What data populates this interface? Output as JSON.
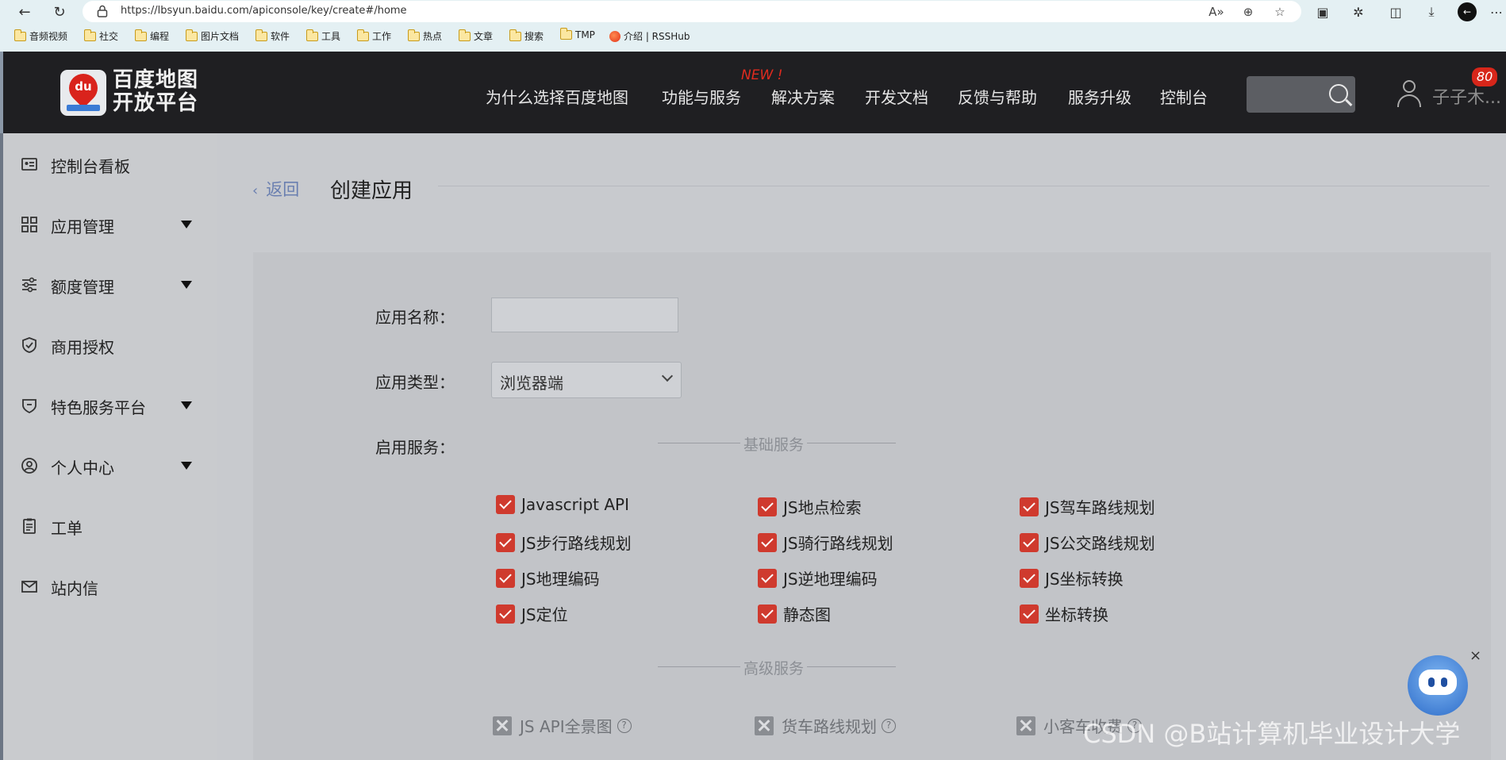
{
  "browser": {
    "url": "https://lbsyun.baidu.com/apiconsole/key/create#/home",
    "bookmarks": [
      "音频视频",
      "社交",
      "编程",
      "图片文档",
      "软件",
      "工具",
      "工作",
      "热点",
      "文章",
      "搜索",
      "TMP",
      "介绍 | RSSHub"
    ]
  },
  "header": {
    "logo_badge": "du",
    "logo_line1": "百度地图",
    "logo_line2": "开放平台",
    "nav": [
      "为什么选择百度地图",
      "功能与服务",
      "解决方案",
      "开发文档",
      "反馈与帮助",
      "服务升级",
      "控制台"
    ],
    "new_tag": "NEW !",
    "user_name": "子子木...",
    "badge_count": "80"
  },
  "sidebar": {
    "items": [
      {
        "label": "控制台看板",
        "icon": "dashboard-icon",
        "caret": false
      },
      {
        "label": "应用管理",
        "icon": "grid-icon",
        "caret": true
      },
      {
        "label": "额度管理",
        "icon": "sliders-icon",
        "caret": true
      },
      {
        "label": "商用授权",
        "icon": "shield-check-icon",
        "caret": false
      },
      {
        "label": "特色服务平台",
        "icon": "pin-icon",
        "caret": true
      },
      {
        "label": "个人中心",
        "icon": "user-circle-icon",
        "caret": true
      },
      {
        "label": "工单",
        "icon": "clipboard-icon",
        "caret": false
      },
      {
        "label": "站内信",
        "icon": "mail-icon",
        "caret": false
      }
    ]
  },
  "main": {
    "back_label": "返回",
    "page_title": "创建应用",
    "form": {
      "app_name_label": "应用名称：",
      "app_name_value": "",
      "app_type_label": "应用类型：",
      "app_type_value": "浏览器端",
      "services_label": "启用服务：",
      "basic_section": "基础服务",
      "advanced_section": "高级服务",
      "basic_services": [
        "Javascript API",
        "JS地点检索",
        "JS驾车路线规划",
        "JS步行路线规划",
        "JS骑行路线规划",
        "JS公交路线规划",
        "JS地理编码",
        "JS逆地理编码",
        "JS坐标转换",
        "JS定位",
        "静态图",
        "坐标转换"
      ],
      "advanced_services": [
        "JS API全景图",
        "货车路线规划",
        "小客车收费"
      ]
    }
  },
  "overlay": {
    "close": "×",
    "watermark": "CSDN @B站计算机毕业设计大学"
  }
}
